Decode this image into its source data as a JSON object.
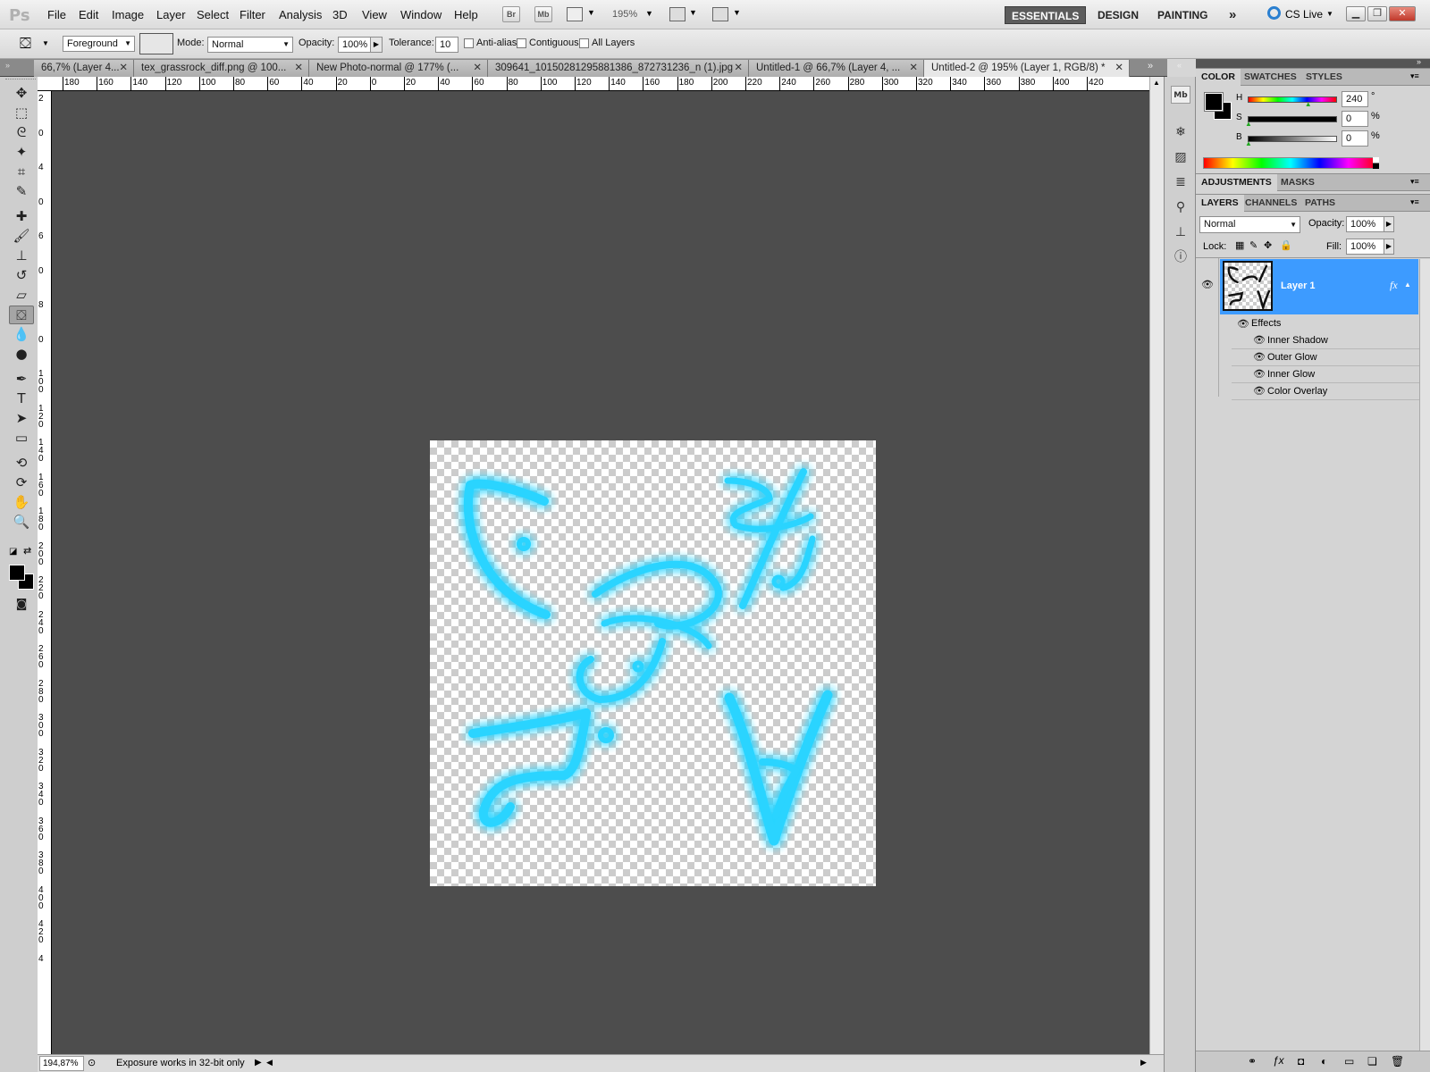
{
  "app": {
    "logo": "Ps"
  },
  "menu": [
    "File",
    "Edit",
    "Image",
    "Layer",
    "Select",
    "Filter",
    "Analysis",
    "3D",
    "View",
    "Window",
    "Help"
  ],
  "appbar": {
    "br": "Br",
    "mb": "Mb",
    "zoom": "195%"
  },
  "workspaces": {
    "essentials": "ESSENTIALS",
    "design": "DESIGN",
    "painting": "PAINTING",
    "more": "»",
    "cslive": "CS Live"
  },
  "options": {
    "fill_source": "Foreground",
    "mode_label": "Mode:",
    "mode_value": "Normal",
    "opacity_label": "Opacity:",
    "opacity_value": "100%",
    "tolerance_label": "Tolerance:",
    "tolerance_value": "10",
    "antialias": "Anti-alias",
    "contiguous": "Contiguous",
    "all_layers": "All Layers"
  },
  "tabs": [
    {
      "label": "66,7% (Layer 4..."
    },
    {
      "label": "tex_grassrock_diff.png @ 100..."
    },
    {
      "label": "New Photo-normal @ 177% (..."
    },
    {
      "label": "309641_10150281295881386_872731236_n (1).jpg"
    },
    {
      "label": "Untitled-1 @ 66,7% (Layer 4, ..."
    },
    {
      "label": "Untitled-2 @ 195% (Layer 1, RGB/8) *"
    }
  ],
  "ruler_h": [
    "180",
    "160",
    "140",
    "120",
    "100",
    "80",
    "60",
    "40",
    "20",
    "0",
    "20",
    "40",
    "60",
    "80",
    "100",
    "120",
    "140",
    "160",
    "180",
    "200",
    "220",
    "240",
    "260",
    "280",
    "300",
    "320",
    "340",
    "360",
    "380",
    "400",
    "420"
  ],
  "ruler_v": [
    "2",
    "0",
    "4",
    "0",
    "6",
    "0",
    "8",
    "0",
    "1 0 0",
    "1 2 0",
    "1 4 0",
    "1 6 0",
    "1 8 0",
    "2 0 0",
    "2 2 0",
    "2 4 0",
    "2 6 0",
    "2 8 0",
    "3 0 0",
    "3 2 0",
    "3 4 0",
    "3 6 0",
    "3 8 0",
    "4 0 0",
    "4 2 0",
    "4"
  ],
  "status": {
    "zoom": "194,87%",
    "message": "Exposure works in 32-bit only"
  },
  "color_panel": {
    "tabs": [
      "COLOR",
      "SWATCHES",
      "STYLES"
    ],
    "h_label": "H",
    "h_value": "240",
    "h_unit": "°",
    "s_label": "S",
    "s_value": "0",
    "s_unit": "%",
    "b_label": "B",
    "b_value": "0",
    "b_unit": "%",
    "hue_level": 0.667
  },
  "adjust_panel": {
    "tabs": [
      "ADJUSTMENTS",
      "MASKS"
    ]
  },
  "layers_panel": {
    "tabs": [
      "LAYERS",
      "CHANNELS",
      "PATHS"
    ],
    "blend": "Normal",
    "opacity_label": "Opacity:",
    "opacity_value": "100%",
    "lock_label": "Lock:",
    "fill_label": "Fill:",
    "fill_value": "100%",
    "layer_name": "Layer 1",
    "fx": "fx",
    "effects_label": "Effects",
    "effects": [
      "Inner Shadow",
      "Outer Glow",
      "Inner Glow",
      "Color Overlay"
    ]
  },
  "colors": {
    "glow": "#29d4ff",
    "selection": "#3399ff",
    "canvas_bg": "#4d4d4d"
  }
}
